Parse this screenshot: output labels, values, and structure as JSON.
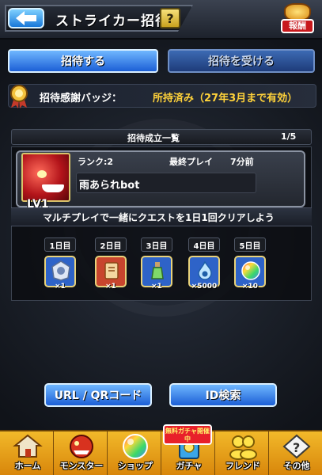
{
  "header": {
    "title": "ストライカー招待",
    "help_label": "?",
    "reward_label": "報酬"
  },
  "tabs": [
    {
      "label": "招待する",
      "active": true
    },
    {
      "label": "招待を受ける",
      "active": false
    }
  ],
  "badge": {
    "label": "招待感謝バッジ：",
    "status": "所持済み（27年3月まで有効）"
  },
  "invite_list": {
    "title": "招待成立一覧",
    "count": "1/5",
    "members": [
      {
        "rank": "ランク:2",
        "last_play_label": "最終プレイ",
        "last_play_value": "7分前",
        "name": "雨あられbot",
        "level": "LV1"
      }
    ],
    "quest_message": "マルチプレイで一緒にクエストを1日1回クリアしよう",
    "days": [
      {
        "label": "1日目",
        "reward_icon": "badge-icon",
        "qty": "×1",
        "color": "#2e63c8"
      },
      {
        "label": "2日目",
        "reward_icon": "scroll-icon",
        "qty": "×1",
        "color": "#c8452e"
      },
      {
        "label": "3日目",
        "reward_icon": "bottle-icon",
        "qty": "×1",
        "color": "#2e63c8"
      },
      {
        "label": "4日目",
        "reward_icon": "flame-icon",
        "qty": "×5000",
        "color": "#2e63c8"
      },
      {
        "label": "5日目",
        "reward_icon": "orb-icon",
        "qty": "×10",
        "color": "#2e63c8"
      }
    ]
  },
  "actions": {
    "url_qr": "URL / QRコード",
    "id_search": "ID検索"
  },
  "bottom_nav": {
    "gacha_tag": "無料ガチャ開催中",
    "items": [
      {
        "label": "ホーム",
        "icon": "home-icon"
      },
      {
        "label": "モンスター",
        "icon": "monster-icon"
      },
      {
        "label": "ショップ",
        "icon": "orb-icon"
      },
      {
        "label": "ガチャ",
        "icon": "gacha-icon"
      },
      {
        "label": "フレンド",
        "icon": "friends-icon"
      },
      {
        "label": "その他",
        "icon": "other-icon"
      }
    ]
  },
  "colors": {
    "accent_blue": "#1c5fd6",
    "badge_gold": "#ffd23a",
    "nav_orange": "#e49a14"
  }
}
